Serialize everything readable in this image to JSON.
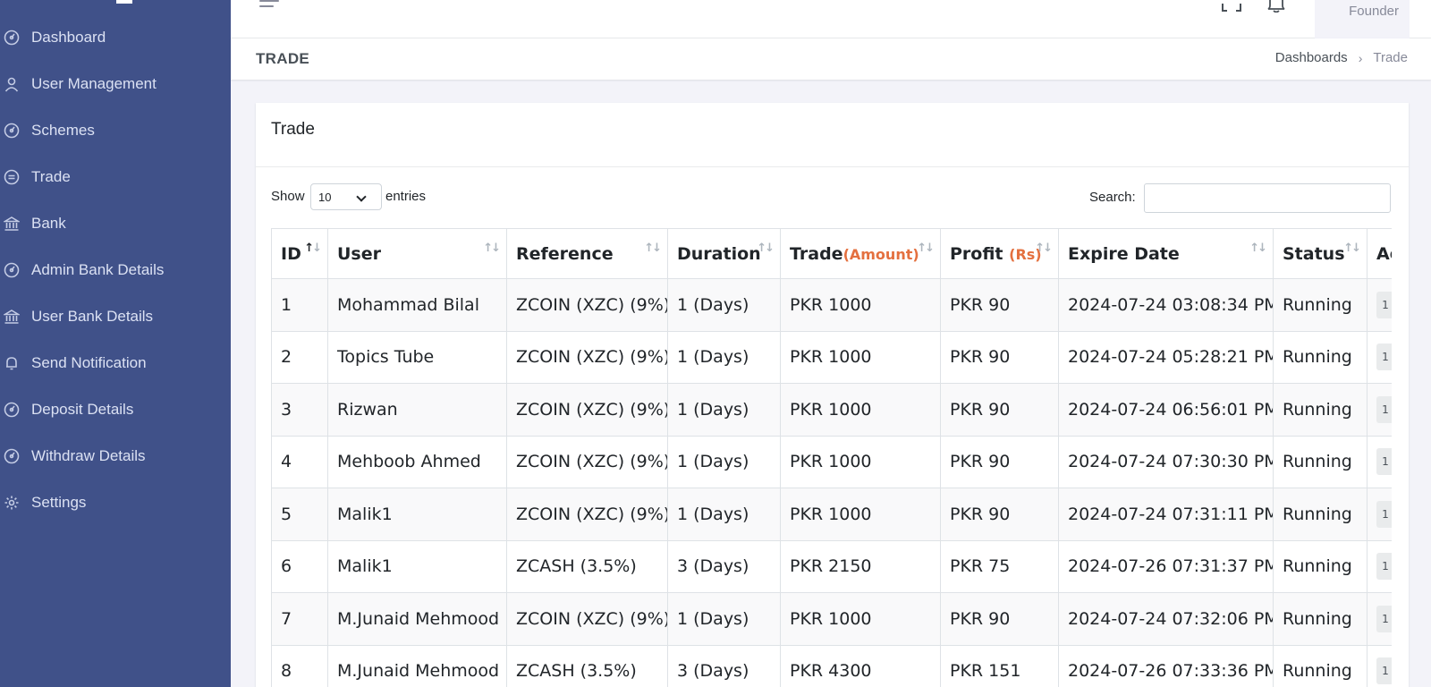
{
  "sidebar": {
    "items": [
      {
        "label": "Dashboard",
        "icon": "dashboard-icon"
      },
      {
        "label": "User Management",
        "icon": "user-icon"
      },
      {
        "label": "Schemes",
        "icon": "dashboard-icon"
      },
      {
        "label": "Trade",
        "icon": "trade-icon"
      },
      {
        "label": "Bank",
        "icon": "bank-icon"
      },
      {
        "label": "Admin Bank Details",
        "icon": "dashboard-icon"
      },
      {
        "label": "User Bank Details",
        "icon": "bank-icon"
      },
      {
        "label": "Send Notification",
        "icon": "bell-icon"
      },
      {
        "label": "Deposit Details",
        "icon": "dashboard-icon"
      },
      {
        "label": "Withdraw Details",
        "icon": "dashboard-icon"
      },
      {
        "label": "Settings",
        "icon": "gear-icon"
      }
    ]
  },
  "header": {
    "user_role": "Founder"
  },
  "page": {
    "title": "TRADE",
    "breadcrumb": {
      "parent": "Dashboards",
      "separator": "›",
      "current": "Trade"
    }
  },
  "card": {
    "title": "Trade",
    "show_label": "Show",
    "entries_value": "10",
    "entries_label": "entries",
    "search_label": "Search:",
    "search_value": ""
  },
  "table": {
    "columns": [
      {
        "label": "ID",
        "unit": ""
      },
      {
        "label": "User",
        "unit": ""
      },
      {
        "label": "Reference",
        "unit": ""
      },
      {
        "label": "Duration",
        "unit": ""
      },
      {
        "label": "Trade",
        "unit": "(Amount)"
      },
      {
        "label": "Profit ",
        "unit": "(Rs)"
      },
      {
        "label": "Expire Date",
        "unit": ""
      },
      {
        "label": "Status",
        "unit": ""
      },
      {
        "label": "Ac",
        "unit": ""
      }
    ],
    "rows": [
      {
        "id": "1",
        "user": "Mohammad Bilal",
        "reference": "ZCOIN (XZC) (9%)",
        "duration": "1 (Days)",
        "trade": "PKR 1000",
        "profit": "PKR 90",
        "expire": "2024-07-24 03:08:34 PM",
        "status": "Running",
        "action": "1"
      },
      {
        "id": "2",
        "user": "Topics Tube",
        "reference": "ZCOIN (XZC) (9%)",
        "duration": "1 (Days)",
        "trade": "PKR 1000",
        "profit": "PKR 90",
        "expire": "2024-07-24 05:28:21 PM",
        "status": "Running",
        "action": "1"
      },
      {
        "id": "3",
        "user": "Rizwan",
        "reference": "ZCOIN (XZC) (9%)",
        "duration": "1 (Days)",
        "trade": "PKR 1000",
        "profit": "PKR 90",
        "expire": "2024-07-24 06:56:01 PM",
        "status": "Running",
        "action": "1"
      },
      {
        "id": "4",
        "user": "Mehboob Ahmed",
        "reference": "ZCOIN (XZC) (9%)",
        "duration": "1 (Days)",
        "trade": "PKR 1000",
        "profit": "PKR 90",
        "expire": "2024-07-24 07:30:30 PM",
        "status": "Running",
        "action": "1"
      },
      {
        "id": "5",
        "user": "Malik1",
        "reference": "ZCOIN (XZC) (9%)",
        "duration": "1 (Days)",
        "trade": "PKR 1000",
        "profit": "PKR 90",
        "expire": "2024-07-24 07:31:11 PM",
        "status": "Running",
        "action": "1"
      },
      {
        "id": "6",
        "user": "Malik1",
        "reference": "ZCASH (3.5%)",
        "duration": "3 (Days)",
        "trade": "PKR 2150",
        "profit": "PKR 75",
        "expire": "2024-07-26 07:31:37 PM",
        "status": "Running",
        "action": "1"
      },
      {
        "id": "7",
        "user": "M.Junaid Mehmood",
        "reference": "ZCOIN (XZC) (9%)",
        "duration": "1 (Days)",
        "trade": "PKR 1000",
        "profit": "PKR 90",
        "expire": "2024-07-24 07:32:06 PM",
        "status": "Running",
        "action": "1"
      },
      {
        "id": "8",
        "user": "M.Junaid Mehmood",
        "reference": "ZCASH (3.5%)",
        "duration": "3 (Days)",
        "trade": "PKR 4300",
        "profit": "PKR 151",
        "expire": "2024-07-26 07:33:36 PM",
        "status": "Running",
        "action": "1"
      }
    ]
  },
  "colors": {
    "sidebar_bg": "#405189",
    "unit_accent": "#e4703f",
    "page_bg": "#f3f3f9"
  }
}
